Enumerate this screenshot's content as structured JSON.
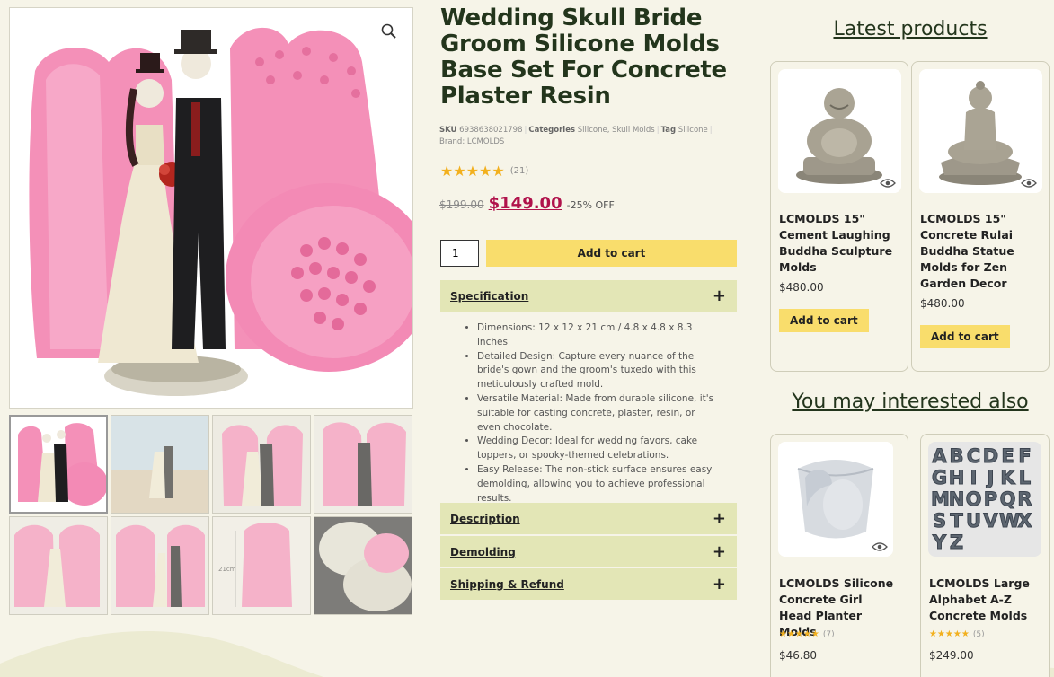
{
  "product": {
    "title": "Wedding Skull Bride Groom Silicone Molds Base Set For Concrete Plaster Resin",
    "sku_label": "SKU",
    "sku": "6938638021798",
    "categories_label": "Categories",
    "categories": "Silicone, Skull Molds",
    "tag_label": "Tag",
    "tag": "Silicone",
    "brand": "Brand: LCMOLDS",
    "rating_stars": "★★★★★",
    "rating_count": "(21)",
    "old_price": "$199.00",
    "new_price": "$149.00",
    "discount": "-25% OFF",
    "quantity": "1",
    "add_to_cart": "Add to cart"
  },
  "accordion": {
    "specification": "Specification",
    "description": "Description",
    "demolding": "Demolding",
    "shipping": "Shipping & Refund",
    "plus": "+",
    "spec_items": [
      "Dimensions: 12 x 12 x 21 cm / 4.8 x 4.8 x 8.3 inches",
      "Detailed Design: Capture every nuance of the bride's gown and the groom's tuxedo with this meticulously crafted mold.",
      "Versatile Material: Made from durable silicone, it's suitable for casting concrete, plaster, resin, or even chocolate.",
      "Wedding Decor: Ideal for wedding favors, cake toppers, or spooky-themed celebrations.",
      "Easy Release: The non-stick surface ensures easy demolding, allowing you to achieve professional results."
    ]
  },
  "gallery": {
    "thumb_dimension_label": "21cm"
  },
  "latest": {
    "title": "Latest products",
    "items": [
      {
        "title": "LCMOLDS 15\" Cement Laughing Buddha Sculpture Molds",
        "price": "$480.00",
        "button": "Add to cart"
      },
      {
        "title": "LCMOLDS 15\" Concrete Rulai Buddha Statue Molds for Zen Garden Decor",
        "price": "$480.00",
        "button": "Add to cart"
      }
    ]
  },
  "interested": {
    "title": "You may interested also",
    "items": [
      {
        "title": "LCMOLDS Silicone Concrete Girl Head Planter Molds",
        "stars": "★★★★★",
        "count": "(7)",
        "price": "$46.80"
      },
      {
        "title": "LCMOLDS Large Alphabet A-Z Concrete Molds",
        "stars": "★★★★★",
        "count": "(5)",
        "price": "$249.00",
        "letters": "ABCDEFGHIJKLMNOPQRSTUVWXYZ"
      }
    ]
  },
  "colors": {
    "background": "#f6f4e8",
    "title_green": "#23351c",
    "accordion_bg": "#e3e6b6",
    "button_yellow": "#f9dd6c",
    "price_red": "#b0124b",
    "mold_pink": "#f490b8"
  },
  "icons": {
    "zoom": "magnifier-icon",
    "quickview": "eye-icon"
  }
}
